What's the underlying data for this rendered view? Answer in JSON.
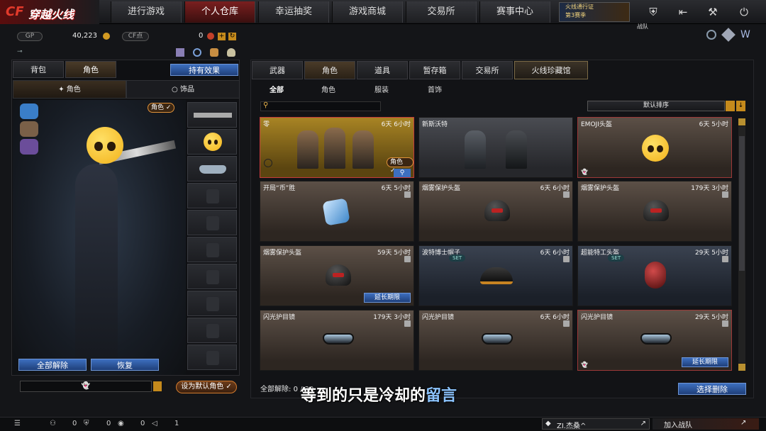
{
  "app": {
    "logo_mark": "CF",
    "logo_text": "穿越火线"
  },
  "nav": {
    "tabs": [
      "进行游戏",
      "个人仓库",
      "幸运抽奖",
      "游戏商城",
      "交易所",
      "赛事中心"
    ],
    "active_index": 1,
    "promo": {
      "line1": "火线通行证",
      "line2": "第3赛季"
    },
    "icons": [
      "shield-icon",
      "back-icon",
      "wrench-icon",
      "power-icon"
    ],
    "tooltip": "战队"
  },
  "currency": {
    "gp_label": "GP",
    "gp_value": "40,223",
    "cf_label": "CF点",
    "cf_value": "0",
    "plus": "+",
    "refresh": "↻"
  },
  "left": {
    "tabs": [
      "背包",
      "角色"
    ],
    "active_tab": 1,
    "effects_button": "持有效果",
    "subtabs": [
      "角色",
      "饰品"
    ],
    "role_badge": "角色 ✓",
    "unequip_all": "全部解除",
    "restore": "恢复",
    "name_value": "👻",
    "set_default": "设为默认角色 ✓"
  },
  "right": {
    "tabs": [
      "武器",
      "角色",
      "道具",
      "暂存箱",
      "交易所",
      "火线珍藏馆"
    ],
    "active_tab": 1,
    "filters": [
      "全部",
      "角色",
      "服装",
      "首饰"
    ],
    "active_filter": 0,
    "sort_label": "默认排序",
    "items": [
      {
        "name": "零",
        "time": "6天 6小时",
        "style": "gold",
        "badge": "角色 ✓",
        "kind": "people"
      },
      {
        "name": "新斯沃特",
        "time": "",
        "style": "grey",
        "kind": "soldiers"
      },
      {
        "name": "EMOJI头盔",
        "time": "6天 5小时",
        "style": "red",
        "kind": "emoji"
      },
      {
        "name": "开局“币”胜",
        "time": "6天 5小时",
        "style": "",
        "kind": "dice"
      },
      {
        "name": "烟雾保护头盔",
        "time": "6天 6小时",
        "style": "",
        "kind": "helmet"
      },
      {
        "name": "烟雾保护头盔",
        "time": "179天 3小时",
        "style": "",
        "kind": "helmet"
      },
      {
        "name": "烟雾保护头盔",
        "time": "59天 5小时",
        "style": "",
        "kind": "helmet",
        "extend": "延长期限"
      },
      {
        "name": "波特博士帽子",
        "time": "6天 6小时",
        "style": "blue",
        "kind": "cap",
        "set": "SET"
      },
      {
        "name": "超能特工头盔",
        "time": "29天 5小时",
        "style": "blue",
        "kind": "redhelmet",
        "set": "SET"
      },
      {
        "name": "闪光护目镜",
        "time": "179天 3小时",
        "style": "",
        "kind": "goggles"
      },
      {
        "name": "闪光护目镜",
        "time": "6天 6小时",
        "style": "",
        "kind": "goggles"
      },
      {
        "name": "闪光护目镜",
        "time": "29天 5小时",
        "style": "red",
        "kind": "goggles",
        "extend": "延长期限"
      }
    ],
    "unequip_all": "全部解除",
    "unequip_count": "0 / 20",
    "select_delete": "选择删除"
  },
  "bottom": {
    "counts": [
      "0",
      "0",
      "0",
      "1"
    ],
    "chat_user": "ZI.杰桑^",
    "join_team": "加入战队"
  },
  "subtitle": {
    "part1": "等到的只是冷却的",
    "part2": "留言"
  }
}
